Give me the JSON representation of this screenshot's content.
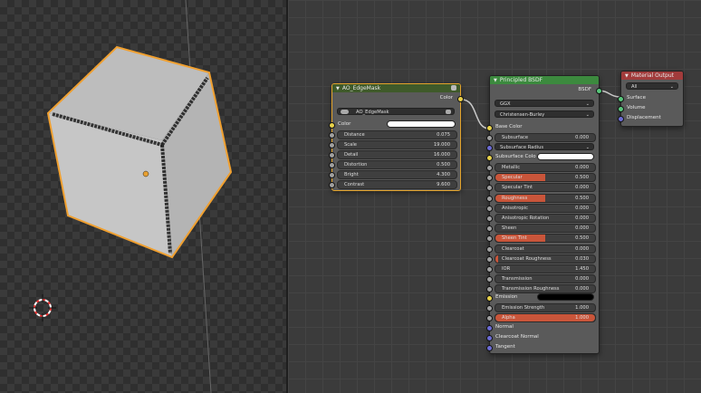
{
  "viewport": {
    "background_colors": {
      "light": "#3a3a3a",
      "dark": "#2f2f2f"
    },
    "selection_outline_color": "#f0a030",
    "object": "cube",
    "cursor": "3d-cursor-icon"
  },
  "ao_node": {
    "title": "AO_EdgeMask",
    "header_color": "#3f5a2a",
    "output_label": "Color",
    "group_selector_value": "AO_EdgeMask",
    "group_icon": "node-group-icon",
    "fake_user_icon": "fake-user-icon",
    "inputs": [
      {
        "label": "Color",
        "type": "color",
        "value_color": "#ffffff"
      },
      {
        "label": "Distance",
        "value": "0.075"
      },
      {
        "label": "Scale",
        "value": "19.000"
      },
      {
        "label": "Detail",
        "value": "16.000"
      },
      {
        "label": "Distortion",
        "value": "0.500"
      },
      {
        "label": "Bright",
        "value": "4.300"
      },
      {
        "label": "Contrast",
        "value": "9.600"
      }
    ]
  },
  "bsdf_node": {
    "title": "Principled BSDF",
    "header_color": "#3c8a3e",
    "output_label": "BSDF",
    "distribution": "GGX",
    "subsurface_method": "Christensen-Burley",
    "base_color_label": "Base Color",
    "subsurface": {
      "label": "Subsurface",
      "value": "0.000"
    },
    "subsurface_radius": "Subsurface Radius",
    "subsurface_color": {
      "label": "Subsurface Colo",
      "value_color": "#ffffff"
    },
    "params": [
      {
        "label": "Metallic",
        "value": "0.000",
        "fill": 0
      },
      {
        "label": "Specular",
        "value": "0.500",
        "fill": 0.5
      },
      {
        "label": "Specular Tint",
        "value": "0.000",
        "fill": 0
      },
      {
        "label": "Roughness",
        "value": "0.500",
        "fill": 0.5
      },
      {
        "label": "Anisotropic",
        "value": "0.000",
        "fill": 0
      },
      {
        "label": "Anisotropic Rotation",
        "value": "0.000",
        "fill": 0
      },
      {
        "label": "Sheen",
        "value": "0.000",
        "fill": 0
      },
      {
        "label": "Sheen Tint",
        "value": "0.500",
        "fill": 0.5
      },
      {
        "label": "Clearcoat",
        "value": "0.000",
        "fill": 0
      },
      {
        "label": "Clearcoat Roughness",
        "value": "0.030",
        "fill": 0.03
      },
      {
        "label": "IOR",
        "value": "1.450",
        "fill": 0
      },
      {
        "label": "Transmission",
        "value": "0.000",
        "fill": 0
      },
      {
        "label": "Transmission Roughness",
        "value": "0.000",
        "fill": 0
      }
    ],
    "emission": {
      "label": "Emission",
      "value_color": "#000000"
    },
    "emission_strength": {
      "label": "Emission Strength",
      "value": "1.000"
    },
    "alpha": {
      "label": "Alpha",
      "value": "1.000",
      "fill": 1
    },
    "vector_inputs": [
      "Normal",
      "Clearcoat Normal",
      "Tangent"
    ]
  },
  "output_node": {
    "title": "Material Output",
    "header_color": "#a13b3b",
    "target": "All",
    "inputs": [
      "Surface",
      "Volume",
      "Displacement"
    ]
  },
  "colors": {
    "slider_fill": "#c9553a",
    "link": "#c8c8c8",
    "selected_node_border": "#e3a32b"
  }
}
